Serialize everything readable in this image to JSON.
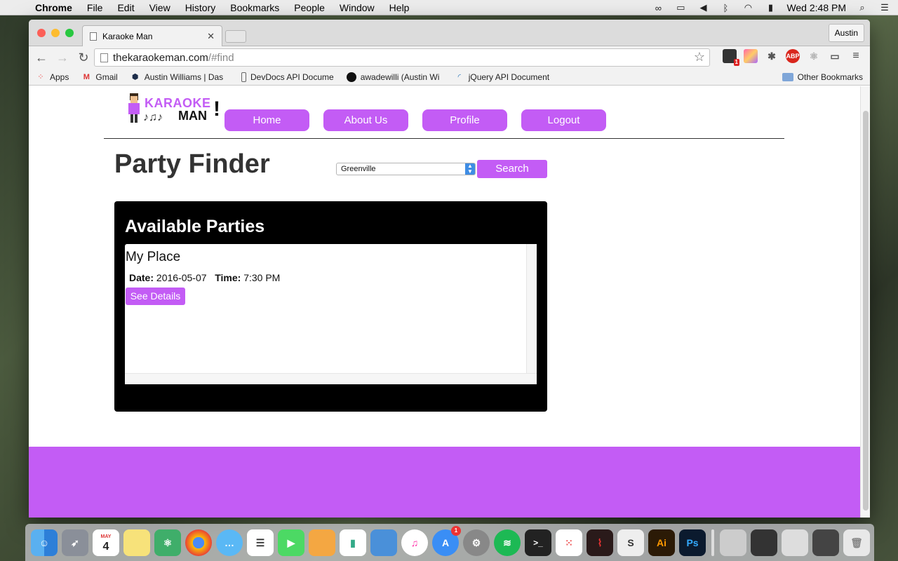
{
  "menubar": {
    "app": "Chrome",
    "items": [
      "File",
      "Edit",
      "View",
      "History",
      "Bookmarks",
      "People",
      "Window",
      "Help"
    ],
    "clock": "Wed 2:48 PM"
  },
  "browser": {
    "tab_title": "Karaoke Man",
    "profile": "Austin",
    "url_host": "thekaraokeman.com",
    "url_path": "/#find",
    "bookmarks": [
      {
        "label": "Apps"
      },
      {
        "label": "Gmail"
      },
      {
        "label": "Austin Williams | Das"
      },
      {
        "label": "DevDocs API Docume"
      },
      {
        "label": "awadewilli (Austin Wi"
      },
      {
        "label": "jQuery API Document"
      }
    ],
    "other_bookmarks": "Other Bookmarks",
    "ext_badge": "1",
    "abp": "ABP"
  },
  "site": {
    "logo_top": "KARAOKE",
    "logo_bottom": "MAN",
    "nav": [
      "Home",
      "About Us",
      "Profile",
      "Logout"
    ],
    "title": "Party Finder",
    "city": "Greenville",
    "search": "Search",
    "panel_title": "Available Parties",
    "party": {
      "name": "My Place",
      "date_label": "Date:",
      "date": "2016-05-07",
      "time_label": "Time:",
      "time": "7:30 PM",
      "details": "See Details"
    }
  },
  "dock": {
    "calendar_month": "MAY",
    "calendar_day": "4",
    "appstore_badge": "1"
  },
  "colors": {
    "accent": "#c35cf5"
  }
}
